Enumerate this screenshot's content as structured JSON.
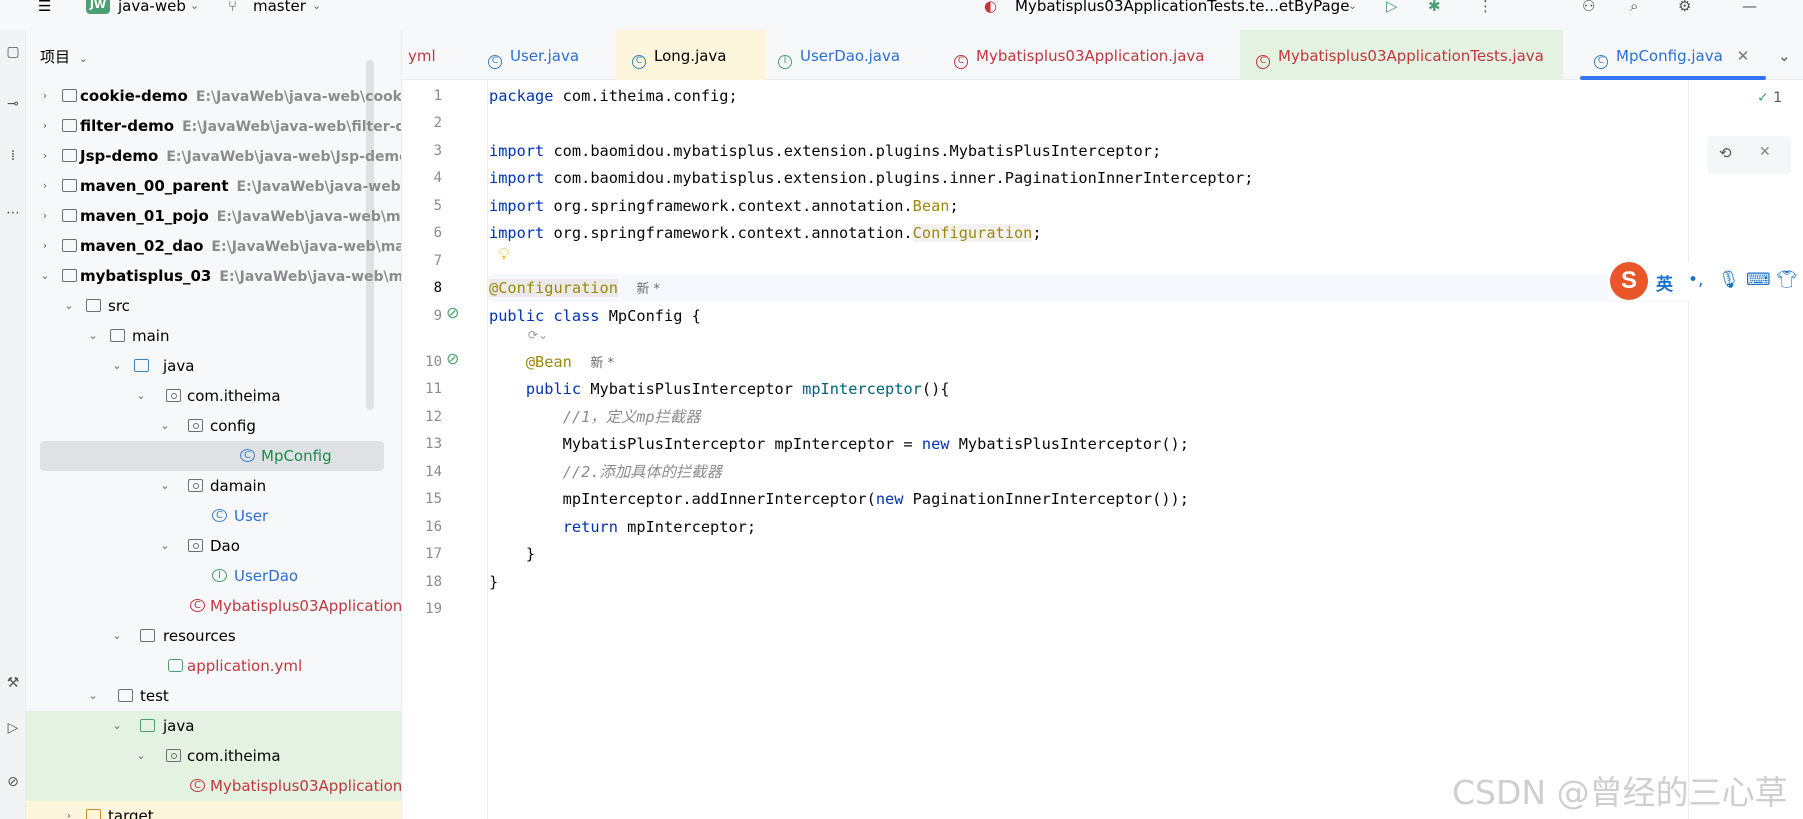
{
  "titlebar": {
    "project_badge": "JW",
    "project_name": "java-web",
    "branch": "master",
    "run_config": "Mybatisplus03ApplicationTests.te...etByPage"
  },
  "project_panel": {
    "header": "项目",
    "items": [
      {
        "label": "cookie-demo",
        "path": "E:\\JavaWeb\\java-web\\cookie"
      },
      {
        "label": "filter-demo",
        "path": "E:\\JavaWeb\\java-web\\filter-de"
      },
      {
        "label": "Jsp-demo",
        "path": "E:\\JavaWeb\\java-web\\Jsp-demo"
      },
      {
        "label": "maven_00_parent",
        "path": "E:\\JavaWeb\\java-web\\m"
      },
      {
        "label": "maven_01_pojo",
        "path": "E:\\JavaWeb\\java-web\\mav"
      },
      {
        "label": "maven_02_dao",
        "path": "E:\\JavaWeb\\java-web\\mav"
      },
      {
        "label": "mybatisplus_03",
        "path": "E:\\JavaWeb\\java-web\\myb"
      },
      {
        "label": "src"
      },
      {
        "label": "main"
      },
      {
        "label": "java"
      },
      {
        "label": "com.itheima"
      },
      {
        "label": "config"
      },
      {
        "label": "MpConfig"
      },
      {
        "label": "damain"
      },
      {
        "label": "User"
      },
      {
        "label": "Dao"
      },
      {
        "label": "UserDao"
      },
      {
        "label": "Mybatisplus03Application"
      },
      {
        "label": "resources"
      },
      {
        "label": "application.yml"
      },
      {
        "label": "test"
      },
      {
        "label": "java"
      },
      {
        "label": "com.itheima"
      },
      {
        "label": "Mybatisplus03Application"
      },
      {
        "label": "target"
      }
    ]
  },
  "tabs": [
    {
      "label": "yml"
    },
    {
      "label": "User.java"
    },
    {
      "label": "Long.java"
    },
    {
      "label": "UserDao.java"
    },
    {
      "label": "Mybatisplus03Application.java"
    },
    {
      "label": "Mybatisplus03ApplicationTests.java"
    },
    {
      "label": "MpConfig.java"
    }
  ],
  "editor": {
    "line_numbers": [
      "1",
      "2",
      "3",
      "4",
      "5",
      "6",
      "7",
      "8",
      "9",
      "10",
      "11",
      "12",
      "13",
      "14",
      "15",
      "16",
      "17",
      "18",
      "19"
    ],
    "hint_new": "新 *",
    "comment1": "//1，定义mp拦截器",
    "comment2": "//2.添加具体的拦截器",
    "problems_count": "1"
  },
  "ime": {
    "logo": "S",
    "lang": "英"
  },
  "watermark": "CSDN @曾经的三心草",
  "colors": {
    "keyword": "#0033b3",
    "annotation": "#9e880d",
    "comment": "#8c8c8c",
    "method": "#00627a",
    "accent": "#3574f0",
    "selection": "#dfe1e5"
  }
}
